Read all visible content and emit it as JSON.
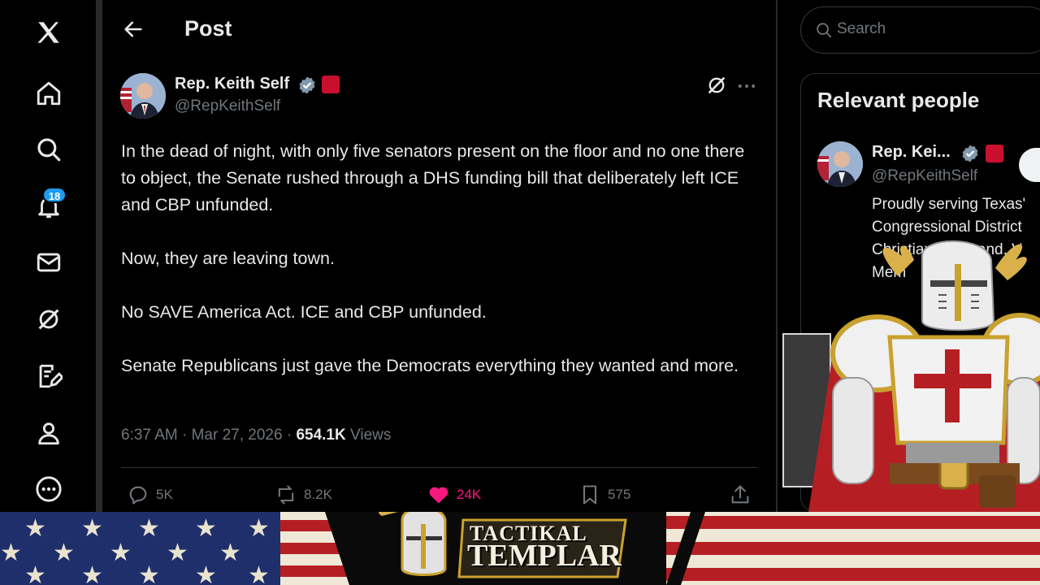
{
  "sidebar": {
    "items": [
      {
        "name": "x-logo",
        "icon": "x-logo-icon"
      },
      {
        "name": "home",
        "icon": "home-icon"
      },
      {
        "name": "explore",
        "icon": "search-icon"
      },
      {
        "name": "notifications",
        "icon": "bell-icon",
        "badge": "18"
      },
      {
        "name": "messages",
        "icon": "mail-icon"
      },
      {
        "name": "grok",
        "icon": "grok-icon"
      },
      {
        "name": "compose",
        "icon": "compose-icon"
      },
      {
        "name": "profile",
        "icon": "person-icon"
      },
      {
        "name": "more",
        "icon": "more-circle-icon"
      }
    ]
  },
  "header": {
    "title": "Post"
  },
  "post": {
    "author_name": "Rep. Keith Self",
    "handle": "@RepKeithSelf",
    "paragraphs": [
      "In the dead of night, with only five senators present on the floor and no one there to object, the Senate rushed through a DHS funding bill that deliberately left ICE and CBP unfunded.",
      "Now, they are leaving town.",
      "No SAVE America Act. ICE and CBP unfunded.",
      "Senate Republicans just gave the Democrats everything they wanted and more."
    ],
    "timestamp": "6:37 AM · Mar 27, 2026 · ",
    "views_count": "654.1K",
    "views_label": " Views",
    "actions": {
      "replies": "5K",
      "reposts": "8.2K",
      "likes": "24K",
      "bookmarks": "575"
    }
  },
  "search": {
    "placeholder": "Search"
  },
  "relevant_people": {
    "title": "Relevant people",
    "name": "Rep. Kei...",
    "handle": "@RepKeithSelf",
    "bio_lines": [
      "Proudly serving Texas'",
      "Congressional District",
      "Christian, Husband, V",
      "Mem"
    ]
  },
  "banner": {
    "title_line1": "TACTIKAL",
    "title_line2": "TEMPLAR"
  },
  "colors": {
    "background": "#000000",
    "text": "#e7e9ea",
    "muted": "#71767b",
    "accent": "#1d9bf0",
    "like": "#f91880",
    "flag_red": "#c8102e",
    "flag_blue": "#1f2f6b"
  }
}
